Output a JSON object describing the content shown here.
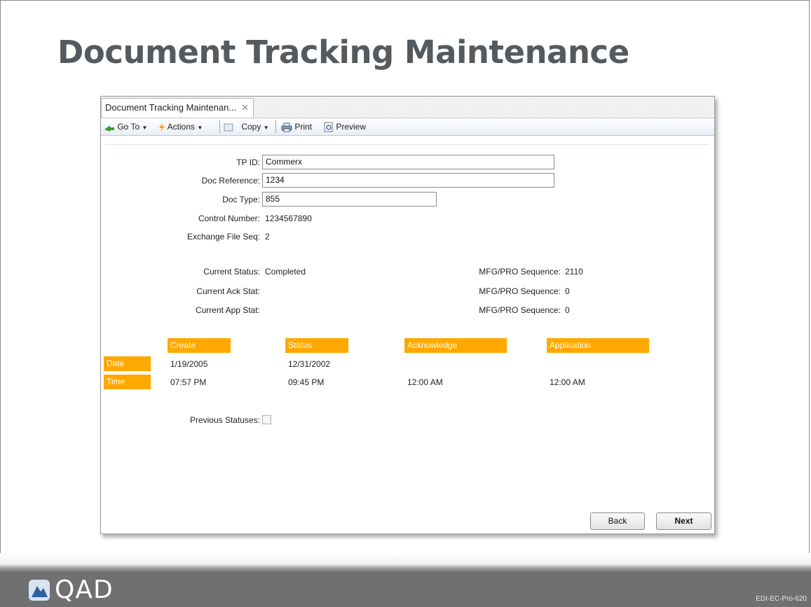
{
  "slide": {
    "title": "Document Tracking Maintenance",
    "code": "EDI-EC-Pro-620",
    "logo_text": "QAD"
  },
  "tab": {
    "label": "Document Tracking Maintenan...",
    "close": "✕"
  },
  "toolbar": {
    "goto": "Go To",
    "actions": "Actions",
    "copy": "Copy",
    "print": "Print",
    "preview": "Preview"
  },
  "form": {
    "tp_id_label": "TP ID:",
    "tp_id_value": "Commerx",
    "doc_ref_label": "Doc Reference:",
    "doc_ref_value": "1234",
    "doc_type_label": "Doc Type:",
    "doc_type_value": "855",
    "control_label": "Control Number:",
    "control_value": "1234567890",
    "exchange_label": "Exchange File Seq:",
    "exchange_value": "2",
    "cur_status_label": "Current Status:",
    "cur_status_value": "Completed",
    "cur_ack_label": "Current Ack Stat:",
    "cur_app_label": "Current App Stat:",
    "seq1_label": "MFG/PRO Sequence:",
    "seq1_value": "2110",
    "seq2_label": "MFG/PRO Sequence:",
    "seq2_value": "0",
    "seq3_label": "MFG/PRO Sequence:",
    "seq3_value": "0",
    "previous_label": "Previous Statuses:"
  },
  "grid": {
    "columns": [
      "Create",
      "Status",
      "Acknowledge",
      "Application"
    ],
    "rows": [
      {
        "label": "Date",
        "values": [
          "1/19/2005",
          "12/31/2002",
          "",
          ""
        ]
      },
      {
        "label": "Time",
        "values": [
          "07:57 PM",
          "09:45 PM",
          "12:00 AM",
          "12:00 AM"
        ]
      }
    ]
  },
  "buttons": {
    "back": "Back",
    "next": "Next"
  },
  "colors": {
    "header_orange": "#ffa800",
    "footer_gray": "#707070"
  }
}
